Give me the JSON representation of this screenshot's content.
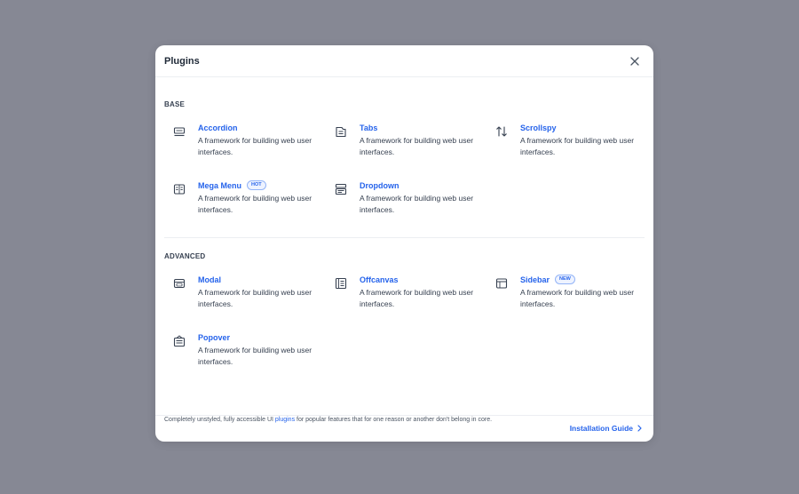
{
  "modal": {
    "title": "Plugins",
    "close_icon": "close-icon"
  },
  "sections": {
    "base": {
      "label": "BASE",
      "items": [
        {
          "name": "Accordion",
          "desc": "A framework for building web user interfaces.",
          "icon": "accordion-icon"
        },
        {
          "name": "Tabs",
          "desc": "A framework for building web user interfaces.",
          "icon": "tabs-icon"
        },
        {
          "name": "Scrollspy",
          "desc": "A framework for building web user interfaces.",
          "icon": "scrollspy-icon"
        },
        {
          "name": "Mega Menu",
          "badge": "HOT",
          "desc": "A framework for building web user interfaces.",
          "icon": "mega-menu-icon"
        },
        {
          "name": "Dropdown",
          "desc": "A framework for building web user interfaces.",
          "icon": "dropdown-icon"
        }
      ]
    },
    "advanced": {
      "label": "ADVANCED",
      "items": [
        {
          "name": "Modal",
          "desc": "A framework for building web user interfaces.",
          "icon": "modal-icon"
        },
        {
          "name": "Offcanvas",
          "desc": "A framework for building web user interfaces.",
          "icon": "offcanvas-icon"
        },
        {
          "name": "Sidebar",
          "badge": "NEW",
          "desc": "A framework for building web user interfaces.",
          "icon": "sidebar-icon"
        },
        {
          "name": "Popover",
          "desc": "A framework for building web user interfaces.",
          "icon": "popover-icon"
        }
      ]
    }
  },
  "footnote": {
    "before": "Completely unstyled, fully accessible UI ",
    "link": "plugins",
    "after": " for popular features that for one reason or another don't belong in core."
  },
  "footer": {
    "guide_label": "Installation Guide",
    "guide_icon": "chevron-right-icon"
  },
  "colors": {
    "backdrop": "#868894",
    "accent": "#2563eb",
    "text": "#374151"
  }
}
